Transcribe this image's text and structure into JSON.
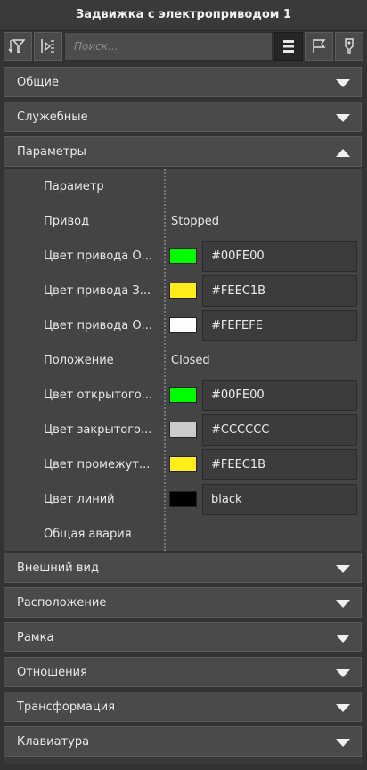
{
  "window": {
    "title": "Задвижка с электроприводом 1"
  },
  "toolbar": {
    "buttons": [
      {
        "icon": "filter-sort-icon"
      },
      {
        "icon": "collapse-icon"
      },
      {
        "icon": "list-view-icon",
        "active": true
      },
      {
        "icon": "flag-icon"
      },
      {
        "icon": "tag-icon"
      }
    ],
    "search_placeholder": "Поиск..."
  },
  "sections": {
    "general": "Общие",
    "service": "Служебные",
    "params": "Параметры",
    "appearance": "Внешний вид",
    "layout": "Расположение",
    "frame": "Рамка",
    "relations": "Отношения",
    "transform": "Трансформация",
    "keyboard": "Клавиатура"
  },
  "params": {
    "header": "Параметр",
    "rows": [
      {
        "label": "Привод",
        "value": "Stopped"
      },
      {
        "label": "Цвет привода О...",
        "color": "#00FE00",
        "value": "#00FE00"
      },
      {
        "label": "Цвет привода З...",
        "color": "#FEEC1B",
        "value": "#FEEC1B"
      },
      {
        "label": "Цвет привода О...",
        "color": "#FEFEFE",
        "value": "#FEFEFE"
      },
      {
        "label": "Положение",
        "value": "Closed"
      },
      {
        "label": "Цвет открытого...",
        "color": "#00FE00",
        "value": "#00FE00"
      },
      {
        "label": "Цвет закрытого...",
        "color": "#CCCCCC",
        "value": "#CCCCCC"
      },
      {
        "label": "Цвет промежут...",
        "color": "#FEEC1B",
        "value": "#FEEC1B"
      },
      {
        "label": "Цвет линий",
        "color": "#000000",
        "value": "black"
      },
      {
        "label": "Общая авария"
      }
    ]
  }
}
